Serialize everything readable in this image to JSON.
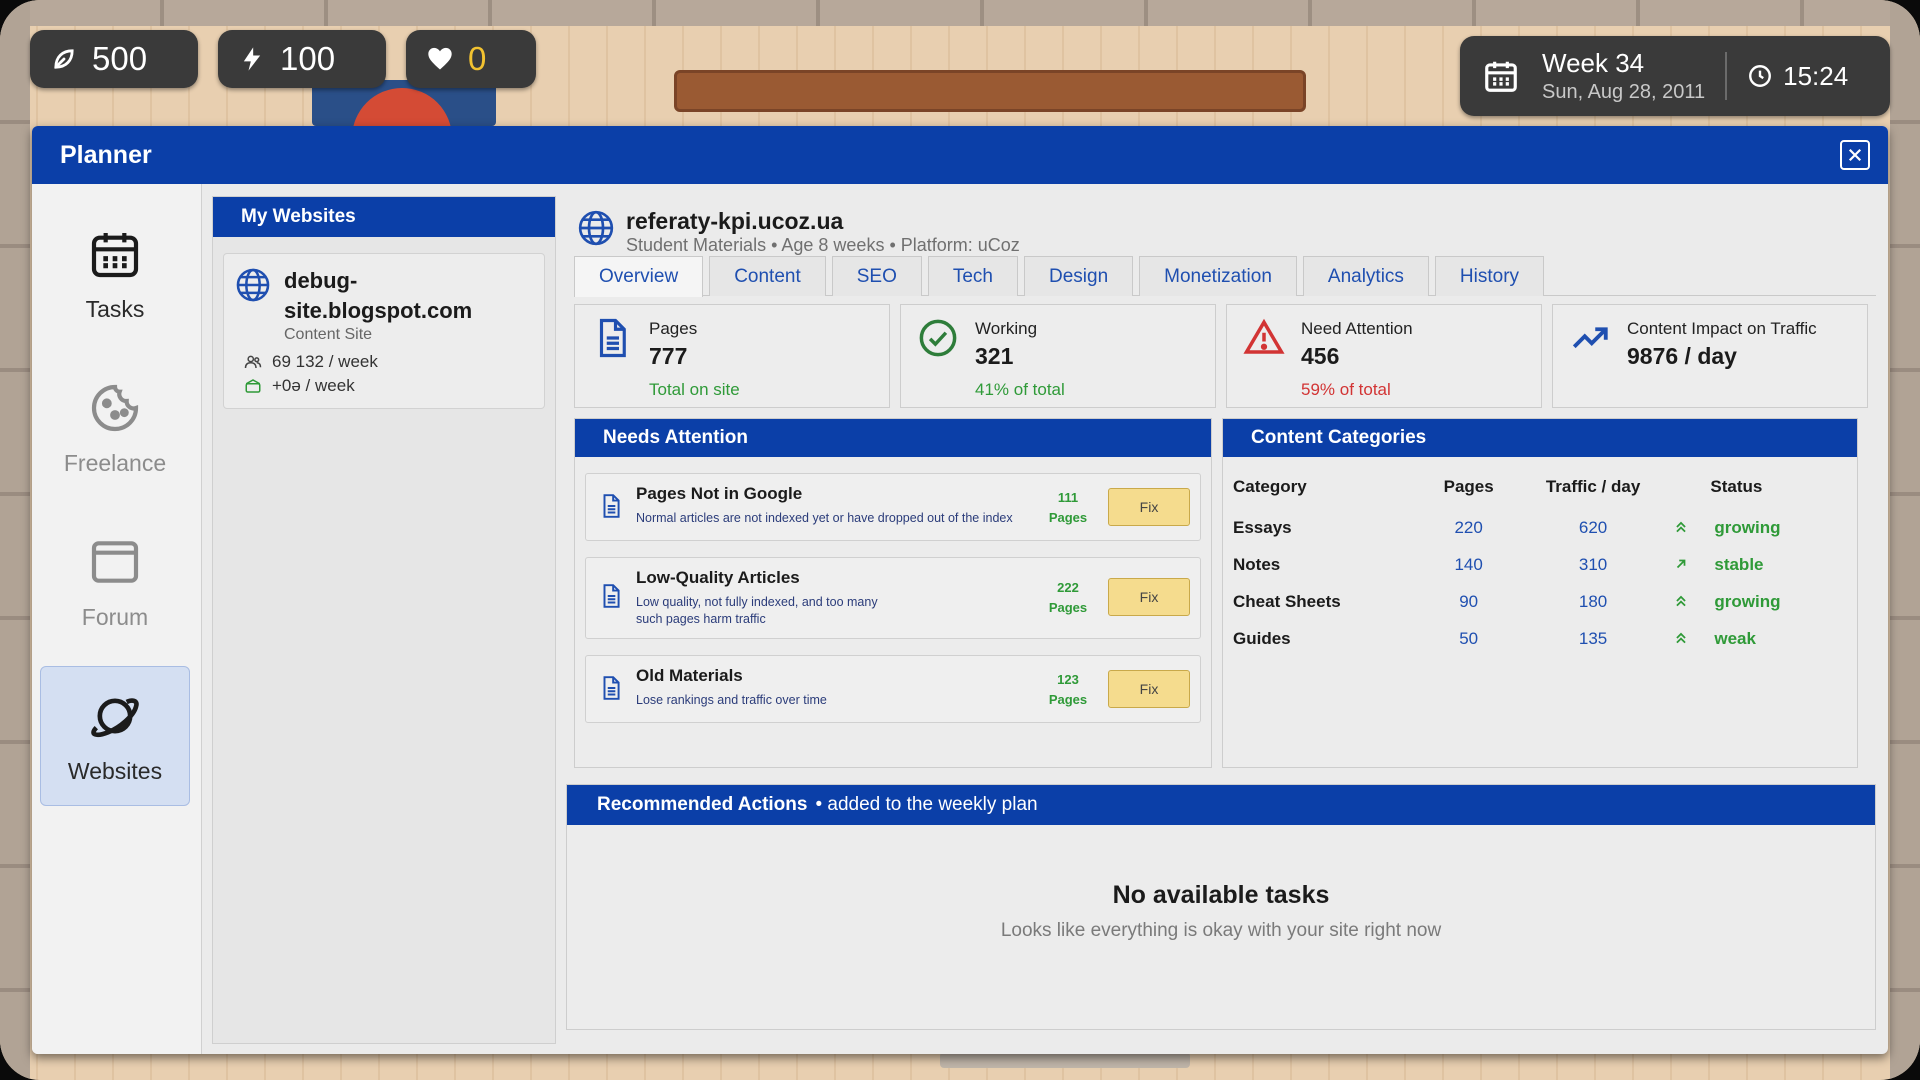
{
  "hud": {
    "money": "500",
    "energy": "100",
    "hearts": "0",
    "week": "Week 34",
    "date": "Sun, Aug 28, 2011",
    "time": "15:24"
  },
  "window": {
    "title": "Planner"
  },
  "nav": {
    "items": [
      {
        "label": "Tasks",
        "icon": "calendar-icon",
        "state": "normal"
      },
      {
        "label": "Freelance",
        "icon": "cookie-icon",
        "state": "disabled"
      },
      {
        "label": "Forum",
        "icon": "window-icon",
        "state": "disabled"
      },
      {
        "label": "Websites",
        "icon": "planet-icon",
        "state": "active"
      }
    ]
  },
  "my_websites": {
    "title": "My Websites",
    "sites": [
      {
        "name": "debug-site.blogspot.com",
        "type": "Content Site",
        "visitors": "69 132 / week",
        "income": "+0ə / week"
      }
    ]
  },
  "site": {
    "domain": "referaty-kpi.ucoz.ua",
    "meta": "Student Materials •   Age 8 weeks • Platform: uCoz"
  },
  "tabs": [
    "Overview",
    "Content",
    "SEO",
    "Tech",
    "Design",
    "Monetization",
    "Analytics",
    "History"
  ],
  "active_tab": "Overview",
  "stats": [
    {
      "label": "Pages",
      "value": "777",
      "sub": "Total on site",
      "color": "#2f9a38"
    },
    {
      "label": "Working",
      "value": "321",
      "sub": "41% of total",
      "color": "#2f9a38"
    },
    {
      "label": "Need Attention",
      "value": "456",
      "sub": "59% of total",
      "color": "#d23434"
    },
    {
      "label": "Content Impact on Traffic",
      "value": "9876 / day",
      "sub": ""
    }
  ],
  "needs_attention": {
    "title": "Needs Attention",
    "items": [
      {
        "title": "Pages Not in Google",
        "desc": "Normal articles are not indexed yet or have dropped out of the index",
        "count": "111",
        "unit": "Pages",
        "button": "Fix"
      },
      {
        "title": "Low-Quality Articles",
        "desc": "Low quality, not fully indexed, and too many such pages harm traffic",
        "count": "222",
        "unit": "Pages",
        "button": "Fix"
      },
      {
        "title": "Old Materials",
        "desc": "Lose rankings and traffic over time",
        "count": "123",
        "unit": "Pages",
        "button": "Fix"
      }
    ]
  },
  "content_categories": {
    "title": "Content Categories",
    "headers": [
      "Category",
      "Pages",
      "Traffic / day",
      "Status"
    ],
    "rows": [
      {
        "category": "Essays",
        "pages": "220",
        "traffic": "620",
        "status": "growing",
        "trend": "double-up"
      },
      {
        "category": "Notes",
        "pages": "140",
        "traffic": "310",
        "status": "stable",
        "trend": "up-right"
      },
      {
        "category": "Cheat Sheets",
        "pages": "90",
        "traffic": "180",
        "status": "growing",
        "trend": "double-up"
      },
      {
        "category": "Guides",
        "pages": "50",
        "traffic": "135",
        "status": "weak",
        "trend": "double-up"
      }
    ]
  },
  "recommended": {
    "title": "Recommended Actions",
    "subtitle": "•  added to the weekly plan",
    "empty_title": "No available tasks",
    "empty_sub": "Looks like everything is okay with your site right now"
  },
  "colors": {
    "accent": "#0b3fa8",
    "link": "#1f4fb0",
    "good": "#2f9a38",
    "bad": "#d23434",
    "gold": "#f2c230"
  }
}
